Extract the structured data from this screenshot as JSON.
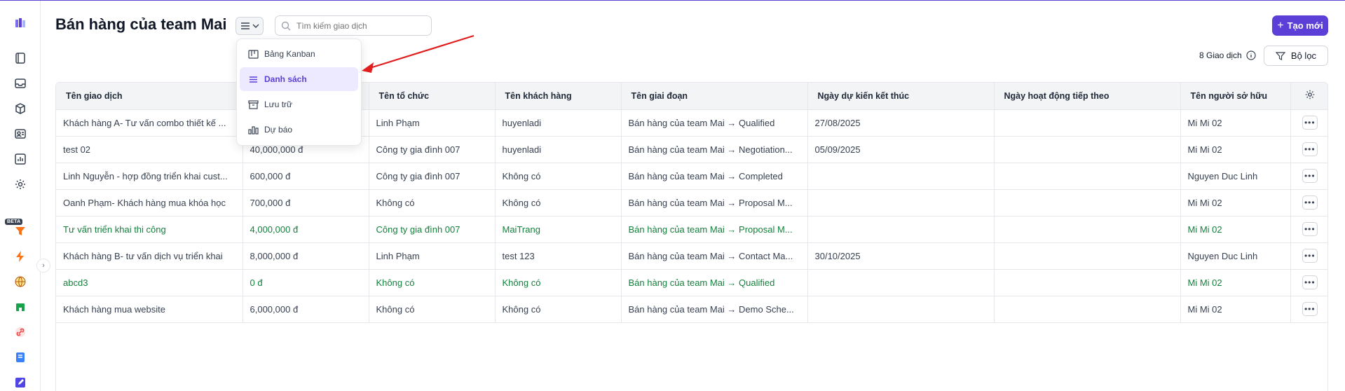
{
  "page": {
    "title": "Bán hàng của team Mai"
  },
  "search": {
    "placeholder": "Tìm kiếm giao dịch"
  },
  "header": {
    "create_label": "Tạo mới",
    "count_label": "8 Giao dịch",
    "filter_label": "Bộ lọc"
  },
  "sidebar": {
    "beta_label": "BETA",
    "icons": [
      "logo-icon",
      "notebook-icon",
      "inbox-icon",
      "package-icon",
      "contact-card-icon",
      "chart-icon",
      "settings-icon",
      "funnel-icon",
      "lightning-icon",
      "globe-icon",
      "store-icon",
      "link-icon",
      "book-icon",
      "edit-icon"
    ]
  },
  "view_menu": {
    "items": [
      {
        "label": "Bảng Kanban",
        "icon": "kanban-icon",
        "active": false
      },
      {
        "label": "Danh sách",
        "icon": "list-icon",
        "active": true
      },
      {
        "label": "Lưu trữ",
        "icon": "archive-icon",
        "active": false
      },
      {
        "label": "Dự báo",
        "icon": "forecast-icon",
        "active": false
      }
    ]
  },
  "table": {
    "columns": [
      "Tên giao dịch",
      "",
      "Tên tổ chức",
      "Tên khách hàng",
      "Tên giai đoạn",
      "Ngày dự kiến kết thúc",
      "Ngày hoạt động tiếp theo",
      "Tên người sở hữu"
    ],
    "rows": [
      {
        "green": false,
        "cells": [
          "Khách hàng A- Tư vấn combo thiết kế ...",
          "",
          "Linh Phạm",
          "huyenladi",
          "Bán hàng của team Mai → Qualified",
          "27/08/2025",
          "",
          "Mi Mi 02"
        ]
      },
      {
        "green": false,
        "cells": [
          "test 02",
          "40,000,000 đ",
          "Công ty gia đình 007",
          "huyenladi",
          "Bán hàng của team Mai → Negotiation...",
          "05/09/2025",
          "",
          "Mi Mi 02"
        ]
      },
      {
        "green": false,
        "cells": [
          "Linh Nguyễn - hợp đồng triển khai cust...",
          "600,000 đ",
          "Công ty gia đình 007",
          "Không có",
          "Bán hàng của team Mai → Completed",
          "",
          "",
          "Nguyen Duc Linh"
        ]
      },
      {
        "green": false,
        "cells": [
          "Oanh Phạm- Khách hàng mua khóa học",
          "700,000 đ",
          "Không có",
          "Không có",
          "Bán hàng của team Mai → Proposal M...",
          "",
          "",
          "Mi Mi 02"
        ]
      },
      {
        "green": true,
        "cells": [
          "Tư vấn triển khai thi công",
          "4,000,000 đ",
          "Công ty gia đình 007",
          "MaiTrang",
          "Bán hàng của team Mai → Proposal M...",
          "",
          "",
          "Mi Mi 02"
        ]
      },
      {
        "green": false,
        "cells": [
          "Khách hàng B- tư vấn dịch vụ triển khai",
          "8,000,000 đ",
          "Linh Phạm",
          "test 123",
          "Bán hàng của team Mai → Contact Ma...",
          "30/10/2025",
          "",
          "Nguyen Duc Linh"
        ]
      },
      {
        "green": true,
        "cells": [
          "abcd3",
          "0 đ",
          "Không có",
          "Không có",
          "Bán hàng của team Mai → Qualified",
          "",
          "",
          "Mi Mi 02"
        ]
      },
      {
        "green": false,
        "cells": [
          "Khách hàng mua website",
          "6,000,000 đ",
          "Không có",
          "Không có",
          "Bán hàng của team Mai → Demo Sche...",
          "",
          "",
          "Mi Mi 02"
        ]
      }
    ],
    "row_action_label": "•••"
  },
  "colors": {
    "accent": "#5b3fd6",
    "green_text": "#15803d",
    "arrow": "#e11d1d"
  }
}
